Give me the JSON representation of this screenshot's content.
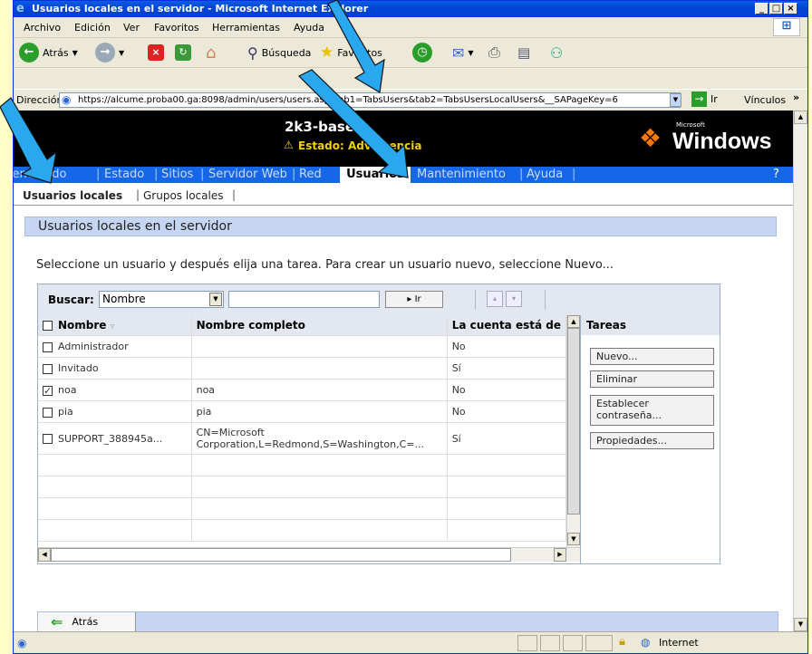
{
  "window": {
    "title": "Usuarios locales en el servidor - Microsoft Internet Explorer"
  },
  "menu": [
    "Archivo",
    "Edición",
    "Ver",
    "Favoritos",
    "Herramientas",
    "Ayuda"
  ],
  "toolbar": {
    "back": "Atrás",
    "search": "Búsqueda",
    "favorites": "Favoritos"
  },
  "address": {
    "label": "Dirección",
    "url": "https://alcume.proba00.ga:8098/admin/users/users.asp?tab1=TabsUsers&tab2=TabsUsersLocalUsers&__SAPageKey=6",
    "go": "Ir",
    "links": "Vínculos"
  },
  "banner": {
    "server": "2k3-base",
    "status": "Estado: Advertencia",
    "logo_small": "Microsoft",
    "logo": "Windows"
  },
  "tabs": [
    "Bienvenido",
    "Estado",
    "Sitios",
    "Servidor Web",
    "Red",
    "Usuarios",
    "Mantenimiento",
    "Ayuda"
  ],
  "active_tab": "Usuarios",
  "help_mark": "?",
  "subtabs": {
    "local_users": "Usuarios locales",
    "local_groups": "Grupos locales"
  },
  "section_title": "Usuarios locales en el servidor",
  "description": "Seleccione un usuario y después elija una tarea. Para crear un usuario nuevo, seleccione Nuevo...",
  "search": {
    "label": "Buscar:",
    "field": "Nombre",
    "go": "Ir"
  },
  "table": {
    "columns": [
      "Nombre",
      "Nombre completo",
      "La cuenta está de"
    ],
    "rows": [
      {
        "name": "Administrador",
        "full": "",
        "disabled": "No",
        "checked": false
      },
      {
        "name": "Invitado",
        "full": "",
        "disabled": "Sí",
        "checked": false
      },
      {
        "name": "noa",
        "full": "noa",
        "disabled": "No",
        "checked": true
      },
      {
        "name": "pia",
        "full": "pia",
        "disabled": "No",
        "checked": false
      },
      {
        "name": "SUPPORT_388945a...",
        "full": "CN=Microsoft Corporation,L=Redmond,S=Washington,C=...",
        "disabled": "Sí",
        "checked": false
      }
    ]
  },
  "tasks": {
    "title": "Tareas",
    "new": "Nuevo...",
    "delete": "Eliminar",
    "set_password": "Establecer contraseña...",
    "properties": "Propiedades..."
  },
  "footer": {
    "back": "Atrás"
  },
  "status": {
    "zone": "Internet"
  },
  "colors": {
    "title_blue": "#0a5de6",
    "tab_blue": "#1666e8",
    "header_blue": "#c6d6f2",
    "arrow": "#2aa8ef"
  }
}
